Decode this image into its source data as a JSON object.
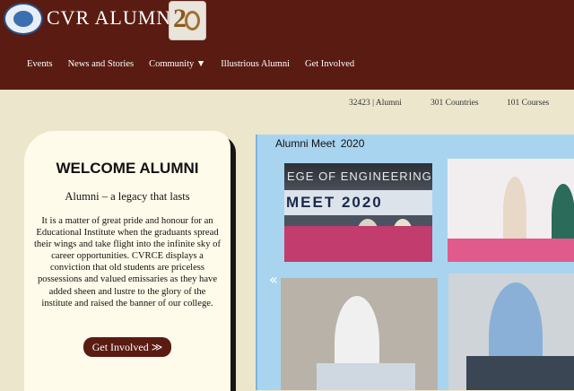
{
  "header": {
    "brand": "CVR ALUMNI",
    "badge_number": "2",
    "nav": [
      "Events",
      "News and Stories",
      "Community ▼",
      "Illustrious Alumni",
      "Get Involved"
    ]
  },
  "stats": {
    "alumni": "32423 | Alumni",
    "countries": "301 Countries",
    "courses": "101 Courses"
  },
  "welcome": {
    "title": "WELCOME ALUMNI",
    "subtitle": "Alumni – a legacy that lasts",
    "body": "It is a matter of great pride and honour for an Educational Institute when the graduants spread their wings and take flight into the infinite sky of career opportunities. CVRCE displays a conviction that old students are priceless possessions and valued emissaries as they have added sheen and lustre to the glory of the institute and raised the banner of our college.",
    "button": "Get Involved ≫"
  },
  "gallery": {
    "title": "Alumni Meet",
    "year": "2020",
    "prev_arrow": "«",
    "banner_line1": "EGE OF ENGINEERING",
    "banner_line2": "MEET 2020"
  },
  "colors": {
    "header_bg": "#5a1c12",
    "page_bg": "#ece6cd",
    "card_bg": "#fffbea",
    "gallery_bg": "#a9d4f0"
  }
}
